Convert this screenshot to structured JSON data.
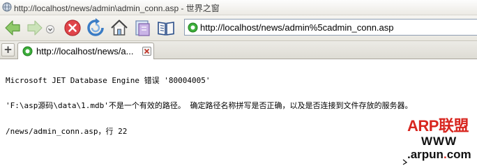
{
  "window": {
    "title": "http://localhost/news/admin\\admin_conn.asp - 世界之窗",
    "icon": "globe-icon"
  },
  "toolbar": {
    "buttons": [
      {
        "name": "back",
        "icon": "back-arrow-icon"
      },
      {
        "name": "forward",
        "icon": "forward-arrow-icon"
      },
      {
        "name": "history-dropdown",
        "icon": "chevron-down-icon"
      },
      {
        "name": "stop",
        "icon": "stop-icon"
      },
      {
        "name": "refresh",
        "icon": "refresh-icon"
      },
      {
        "name": "home",
        "icon": "home-icon"
      },
      {
        "name": "favorites",
        "icon": "favorites-icon"
      },
      {
        "name": "bookmarks",
        "icon": "book-icon"
      }
    ],
    "address": "http://localhost/news/admin%5cadmin_conn.asp"
  },
  "tabs": [
    {
      "label": "http://localhost/news/a...",
      "active": true
    }
  ],
  "content": {
    "line1": "Microsoft JET Database Engine 错误 '80004005'",
    "line2": "'F:\\asp源码\\data\\1.mdb'不是一个有效的路径。 确定路径名称拼写是否正确，以及是否连接到文件存放的服务器。",
    "line3": "/news/admin_conn.asp，行 22"
  },
  "watermark": {
    "brand": "ARP联盟",
    "www": "WWW",
    "domain_prefix": ".arpun",
    "domain_dot": ".",
    "domain_suffix": "com"
  },
  "colors": {
    "watermark_red": "#d8261f",
    "address_favicon": "#3cae3a",
    "stop_button": "#e0454a"
  }
}
